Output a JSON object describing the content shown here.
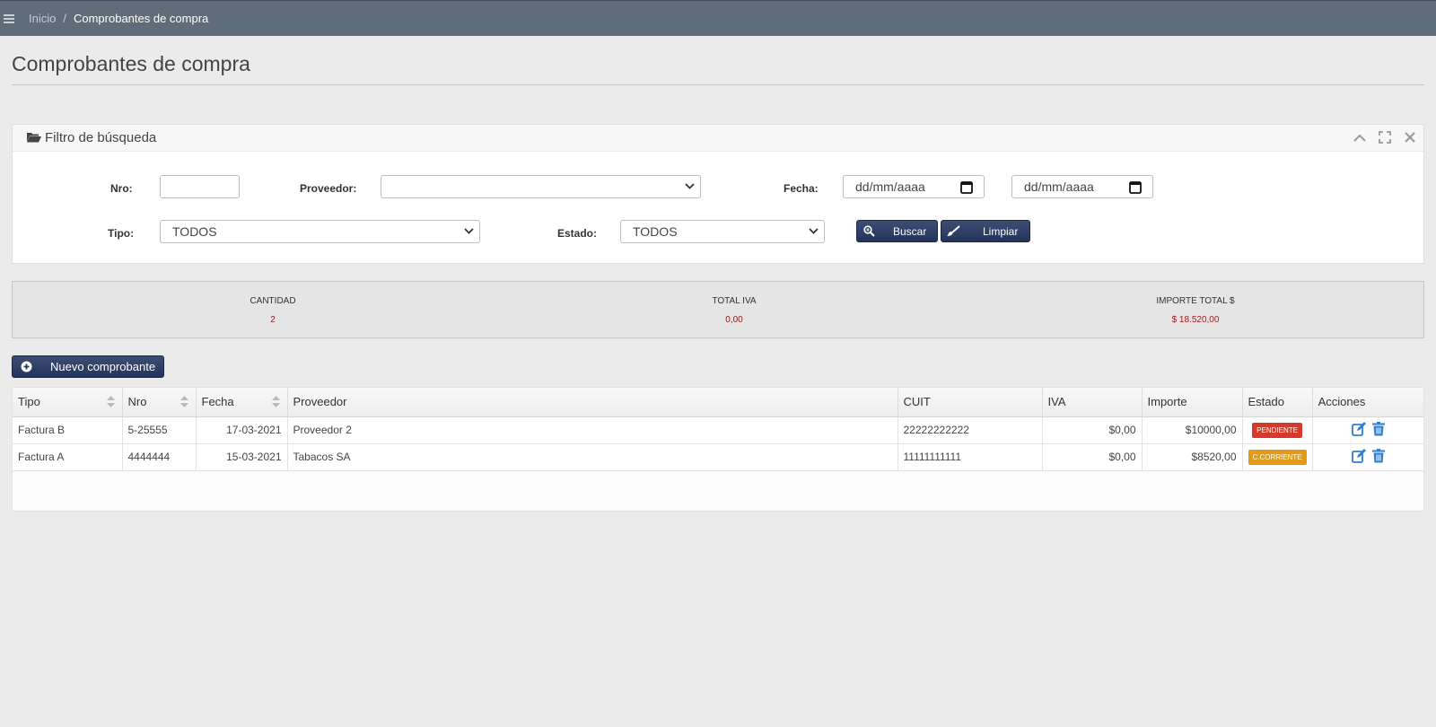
{
  "breadcrumb": {
    "home": "Inicio",
    "separator": "/",
    "current": "Comprobantes de compra"
  },
  "page": {
    "title": "Comprobantes de compra"
  },
  "filter": {
    "title": "Filtro de búsqueda",
    "nro_label": "Nro:",
    "nro_value": "",
    "proveedor_label": "Proveedor:",
    "proveedor_value": "",
    "fecha_label": "Fecha:",
    "fecha_desde_placeholder": "dd/mm/aaaa",
    "fecha_hasta_placeholder": "dd/mm/aaaa",
    "tipo_label": "Tipo:",
    "tipo_value": "TODOS",
    "estado_label": "Estado:",
    "estado_value": "TODOS",
    "buscar_label": "Buscar",
    "limpiar_label": "Limpiar",
    "icons": [
      "folder-open-icon",
      "chevron-up-icon",
      "expand-icon",
      "close-icon",
      "search-icon",
      "brush-icon",
      "calendar-icon"
    ]
  },
  "summary": {
    "cantidad_label": "CANTIDAD",
    "cantidad_value": "2",
    "iva_label": "TOTAL IVA",
    "iva_value": "0,00",
    "importe_label": "IMPORTE TOTAL $",
    "importe_value": "$ 18.520,00"
  },
  "actions": {
    "nuevo_label": "Nuevo comprobante"
  },
  "table": {
    "headers": [
      "Tipo",
      "Nro",
      "Fecha",
      "Proveedor",
      "CUIT",
      "IVA",
      "Importe",
      "Estado",
      "Acciones"
    ],
    "rows": [
      {
        "tipo": "Factura B",
        "nro": "5-25555",
        "fecha": "17-03-2021",
        "proveedor": "Proveedor 2",
        "cuit": "22222222222",
        "iva": "$0,00",
        "importe": "$10000,00",
        "estado": "PENDIENTE",
        "estado_color": "#d9392b"
      },
      {
        "tipo": "Factura A",
        "nro": "4444444",
        "fecha": "15-03-2021",
        "proveedor": "Tabacos SA",
        "cuit": "11111111111",
        "iva": "$0,00",
        "importe": "$8520,00",
        "estado": "C.CORRIENTE",
        "estado_color": "#e39a17"
      }
    ]
  },
  "colors": {
    "topbar": "#5f6c79",
    "button_dark": "#2a3c62",
    "action_icon": "#2e7fd0",
    "summary_value": "#a01818"
  }
}
